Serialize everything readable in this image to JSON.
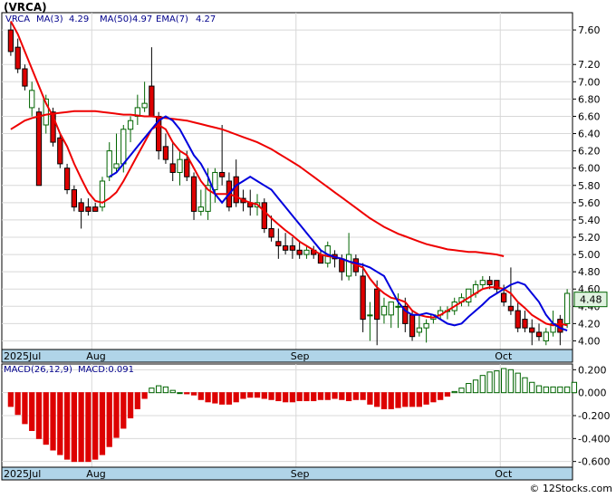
{
  "ticker_title": "(VRCA)",
  "legend": {
    "symbol": "VRCA",
    "ma3_label": "MA(3)",
    "ma3_value": "4.29",
    "ma50_label": "MA(50)",
    "ma50_value": "4.97",
    "ema7_label": "EMA(7)",
    "ema7_value": "4.27"
  },
  "macd_legend": {
    "label": "MACD(26,12,9)",
    "value_label": "MACD:0.091"
  },
  "last_price_label": "4.48",
  "footer": "© 12Stocks.com",
  "colors": {
    "up": "#ffffff",
    "down": "#dd0000",
    "up_border": "#006400",
    "ma50": "#ee0000",
    "ema7": "#ee0000",
    "ma3": "#0000dd",
    "axis_band": "#b0d4e8",
    "grid": "#d8d8d8",
    "macd_pos": "#006400",
    "macd_neg": "#dd0000"
  },
  "chart_data": [
    {
      "type": "candlestick",
      "title": "(VRCA)",
      "y_ticks": [
        "4.00",
        "4.20",
        "4.40",
        "4.60",
        "4.80",
        "5.00",
        "5.20",
        "5.40",
        "5.60",
        "5.80",
        "6.00",
        "6.20",
        "6.40",
        "6.60",
        "6.80",
        "7.00",
        "7.20",
        "7.60"
      ],
      "ylim": [
        3.9,
        7.8
      ],
      "x_labels": [
        {
          "label": "2025Jul",
          "index": 0
        },
        {
          "label": "Aug",
          "index": 12
        },
        {
          "label": "Sep",
          "index": 41
        },
        {
          "label": "Oct",
          "index": 70
        }
      ],
      "ohlc": [
        [
          7.6,
          7.7,
          7.3,
          7.35
        ],
        [
          7.4,
          7.5,
          7.1,
          7.15
        ],
        [
          7.15,
          7.2,
          6.9,
          6.95
        ],
        [
          6.7,
          7.0,
          6.6,
          6.9
        ],
        [
          6.65,
          6.7,
          5.8,
          5.8
        ],
        [
          6.5,
          6.85,
          6.4,
          6.8
        ],
        [
          6.65,
          6.7,
          6.25,
          6.3
        ],
        [
          6.35,
          6.4,
          6.0,
          6.05
        ],
        [
          6.0,
          6.05,
          5.7,
          5.75
        ],
        [
          5.75,
          5.8,
          5.5,
          5.55
        ],
        [
          5.6,
          5.65,
          5.3,
          5.5
        ],
        [
          5.55,
          5.65,
          5.45,
          5.5
        ],
        [
          5.55,
          5.6,
          5.5,
          5.5
        ],
        [
          5.55,
          5.9,
          5.5,
          5.85
        ],
        [
          5.9,
          6.3,
          5.85,
          6.2
        ],
        [
          6.0,
          6.4,
          5.95,
          6.05
        ],
        [
          6.05,
          6.5,
          5.95,
          6.45
        ],
        [
          6.45,
          6.6,
          6.3,
          6.55
        ],
        [
          6.6,
          6.85,
          6.5,
          6.7
        ],
        [
          6.7,
          7.0,
          6.65,
          6.75
        ],
        [
          6.95,
          7.4,
          6.7,
          6.6
        ],
        [
          6.6,
          6.65,
          6.1,
          6.2
        ],
        [
          6.25,
          6.4,
          6.05,
          6.1
        ],
        [
          6.05,
          6.3,
          5.85,
          5.95
        ],
        [
          5.95,
          6.2,
          5.8,
          6.1
        ],
        [
          6.1,
          6.2,
          5.85,
          5.9
        ],
        [
          5.9,
          5.95,
          5.4,
          5.5
        ],
        [
          5.5,
          5.75,
          5.45,
          5.55
        ],
        [
          5.5,
          6.0,
          5.4,
          5.8
        ],
        [
          5.75,
          6.0,
          5.6,
          5.95
        ],
        [
          5.95,
          6.5,
          5.8,
          5.9
        ],
        [
          5.85,
          5.95,
          5.5,
          5.55
        ],
        [
          5.9,
          6.1,
          5.55,
          5.6
        ],
        [
          5.65,
          5.75,
          5.5,
          5.6
        ],
        [
          5.6,
          5.75,
          5.45,
          5.55
        ],
        [
          5.55,
          5.7,
          5.45,
          5.6
        ],
        [
          5.6,
          5.65,
          5.25,
          5.3
        ],
        [
          5.3,
          5.45,
          5.15,
          5.2
        ],
        [
          5.15,
          5.3,
          4.95,
          5.1
        ],
        [
          5.1,
          5.25,
          5.0,
          5.05
        ],
        [
          5.1,
          5.2,
          4.95,
          5.05
        ],
        [
          5.05,
          5.15,
          4.95,
          5.0
        ],
        [
          5.0,
          5.1,
          4.95,
          5.05
        ],
        [
          5.05,
          5.1,
          4.95,
          5.0
        ],
        [
          5.0,
          5.05,
          4.9,
          4.9
        ],
        [
          4.9,
          5.15,
          4.85,
          5.1
        ],
        [
          5.0,
          5.05,
          4.85,
          4.95
        ],
        [
          4.95,
          5.0,
          4.7,
          4.8
        ],
        [
          4.75,
          5.25,
          4.7,
          5.0
        ],
        [
          4.95,
          5.0,
          4.75,
          4.8
        ],
        [
          4.75,
          4.9,
          4.1,
          4.25
        ],
        [
          4.3,
          4.45,
          4.0,
          4.3
        ],
        [
          4.6,
          4.7,
          3.95,
          4.25
        ],
        [
          4.3,
          4.5,
          4.2,
          4.4
        ],
        [
          4.3,
          4.45,
          4.15,
          4.45
        ],
        [
          4.4,
          4.55,
          4.15,
          4.4
        ],
        [
          4.4,
          4.5,
          4.1,
          4.2
        ],
        [
          4.3,
          4.35,
          4.0,
          4.05
        ],
        [
          4.1,
          4.3,
          4.05,
          4.15
        ],
        [
          4.15,
          4.25,
          3.98,
          4.2
        ],
        [
          4.25,
          4.3,
          4.2,
          4.3
        ],
        [
          4.3,
          4.4,
          4.25,
          4.35
        ],
        [
          4.35,
          4.4,
          4.25,
          4.35
        ],
        [
          4.35,
          4.5,
          4.3,
          4.45
        ],
        [
          4.45,
          4.55,
          4.4,
          4.5
        ],
        [
          4.45,
          4.6,
          4.4,
          4.6
        ],
        [
          4.55,
          4.7,
          4.5,
          4.65
        ],
        [
          4.65,
          4.75,
          4.6,
          4.7
        ],
        [
          4.7,
          4.75,
          4.6,
          4.65
        ],
        [
          4.7,
          4.7,
          4.55,
          4.6
        ],
        [
          4.55,
          4.65,
          4.4,
          4.45
        ],
        [
          4.4,
          4.85,
          4.3,
          4.35
        ],
        [
          4.35,
          4.45,
          4.1,
          4.15
        ],
        [
          4.25,
          4.35,
          4.1,
          4.15
        ],
        [
          4.15,
          4.25,
          3.95,
          4.1
        ],
        [
          4.1,
          4.2,
          4.0,
          4.05
        ],
        [
          4.0,
          4.15,
          3.95,
          4.1
        ],
        [
          4.1,
          4.35,
          4.05,
          4.2
        ],
        [
          4.25,
          4.3,
          3.95,
          4.1
        ],
        [
          4.2,
          4.6,
          4.15,
          4.55
        ]
      ],
      "ma3": [
        6.45,
        6.5,
        6.55,
        6.58,
        6.6,
        6.62,
        6.63,
        6.64,
        6.65,
        6.66,
        6.66,
        6.66,
        6.66,
        6.65,
        6.64,
        6.63,
        6.62,
        6.62,
        6.61,
        6.6,
        6.6,
        6.59,
        6.58,
        6.57,
        6.56,
        6.55,
        6.53,
        6.51,
        6.49,
        6.47,
        6.45,
        6.42,
        6.39,
        6.36,
        6.33,
        6.3,
        6.26,
        6.22,
        6.17,
        6.12,
        6.07,
        6.02,
        5.96,
        5.9,
        5.84,
        5.78,
        5.72,
        5.66,
        5.6,
        5.54,
        5.48,
        5.42,
        5.37,
        5.32,
        5.28,
        5.24,
        5.21,
        5.18,
        5.15,
        5.12,
        5.1,
        5.08,
        5.06,
        5.05,
        5.04,
        5.03,
        5.03,
        5.02,
        5.01,
        5.0,
        4.98
      ],
      "ma3_offset": 0,
      "ma50": [
        6.45,
        6.5,
        6.55,
        6.58,
        6.6,
        6.62,
        6.63,
        6.64,
        6.65,
        6.66,
        6.66,
        6.66,
        6.66,
        6.65,
        6.64,
        6.63,
        6.62,
        6.62,
        6.61,
        6.6,
        6.6,
        6.59,
        6.58,
        6.57,
        6.56,
        6.55,
        6.53,
        6.51,
        6.49,
        6.47,
        6.45,
        6.42,
        6.39,
        6.36,
        6.33,
        6.3,
        6.26,
        6.22,
        6.17,
        6.12,
        6.07,
        6.02,
        5.96,
        5.9,
        5.84,
        5.78,
        5.72,
        5.66,
        5.6,
        5.54,
        5.48,
        5.42,
        5.37,
        5.32,
        5.28,
        5.24,
        5.21,
        5.18,
        5.15,
        5.12,
        5.1,
        5.08,
        5.06,
        5.05,
        5.04,
        5.03,
        5.03,
        5.02,
        5.01,
        5.0,
        4.98
      ],
      "ema7": [
        7.7,
        7.55,
        7.35,
        7.15,
        6.95,
        6.75,
        6.6,
        6.4,
        6.25,
        6.05,
        5.88,
        5.72,
        5.62,
        5.6,
        5.65,
        5.72,
        5.85,
        6.0,
        6.15,
        6.3,
        6.45,
        6.5,
        6.45,
        6.3,
        6.2,
        6.15,
        6.0,
        5.85,
        5.75,
        5.7,
        5.7,
        5.7,
        5.67,
        5.63,
        5.6,
        5.58,
        5.5,
        5.42,
        5.35,
        5.28,
        5.22,
        5.15,
        5.1,
        5.05,
        5.0,
        4.98,
        4.97,
        4.95,
        4.92,
        4.88,
        4.85,
        4.72,
        4.62,
        4.55,
        4.5,
        4.48,
        4.45,
        4.35,
        4.3,
        4.28,
        4.27,
        4.3,
        4.35,
        4.4,
        4.45,
        4.5,
        4.55,
        4.6,
        4.62,
        4.62,
        4.6,
        4.55,
        4.45,
        4.38,
        4.3,
        4.25,
        4.2,
        4.18,
        4.2,
        4.18,
        4.27
      ],
      "ma3b": [
        null,
        null,
        null,
        null,
        null,
        null,
        null,
        null,
        null,
        null,
        null,
        null,
        null,
        null,
        5.9,
        5.95,
        6.05,
        6.15,
        6.25,
        6.35,
        6.45,
        6.55,
        6.6,
        6.55,
        6.45,
        6.3,
        6.15,
        6.05,
        5.9,
        5.7,
        5.6,
        5.7,
        5.8,
        5.85,
        5.9,
        5.85,
        5.8,
        5.75,
        5.65,
        5.55,
        5.45,
        5.35,
        5.25,
        5.15,
        5.05,
        5.0,
        4.97,
        4.95,
        4.92,
        4.9,
        4.88,
        4.85,
        4.8,
        4.75,
        4.6,
        4.45,
        4.35,
        4.3,
        4.3,
        4.32,
        4.3,
        4.25,
        4.2,
        4.18,
        4.2,
        4.28,
        4.35,
        4.42,
        4.5,
        4.55,
        4.6,
        4.65,
        4.68,
        4.65,
        4.55,
        4.45,
        4.3,
        4.2,
        4.15,
        4.12,
        4.15,
        4.29
      ]
    },
    {
      "type": "bar",
      "title": "MACD(26,12,9)",
      "y_ticks": [
        "0.200",
        "0.000",
        "-0.200",
        "-0.400",
        "-0.600"
      ],
      "ylim": [
        -0.65,
        0.25
      ],
      "values": [
        -0.12,
        -0.19,
        -0.27,
        -0.33,
        -0.4,
        -0.45,
        -0.5,
        -0.54,
        -0.58,
        -0.6,
        -0.6,
        -0.6,
        -0.58,
        -0.54,
        -0.47,
        -0.39,
        -0.31,
        -0.22,
        -0.14,
        -0.05,
        0.04,
        0.06,
        0.05,
        0.02,
        0.0,
        -0.01,
        -0.02,
        -0.06,
        -0.08,
        -0.09,
        -0.1,
        -0.1,
        -0.08,
        -0.05,
        -0.04,
        -0.04,
        -0.05,
        -0.06,
        -0.07,
        -0.08,
        -0.08,
        -0.07,
        -0.07,
        -0.07,
        -0.06,
        -0.06,
        -0.05,
        -0.06,
        -0.07,
        -0.06,
        -0.06,
        -0.1,
        -0.12,
        -0.14,
        -0.14,
        -0.13,
        -0.12,
        -0.12,
        -0.12,
        -0.1,
        -0.08,
        -0.06,
        -0.03,
        0.01,
        0.04,
        0.08,
        0.11,
        0.15,
        0.18,
        0.19,
        0.21,
        0.2,
        0.17,
        0.13,
        0.09,
        0.06,
        0.05,
        0.05,
        0.05,
        0.05,
        0.09
      ]
    }
  ]
}
